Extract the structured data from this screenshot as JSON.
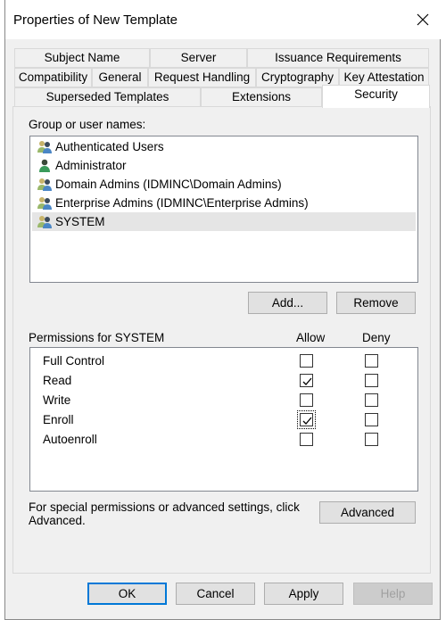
{
  "dialog": {
    "title": "Properties of New Template",
    "close_icon": "close-x"
  },
  "tabs": {
    "row1": [
      {
        "label": "Subject Name"
      },
      {
        "label": "Server"
      },
      {
        "label": "Issuance Requirements"
      }
    ],
    "row2": [
      {
        "label": "Compatibility"
      },
      {
        "label": "General"
      },
      {
        "label": "Request Handling"
      },
      {
        "label": "Cryptography"
      },
      {
        "label": "Key Attestation"
      }
    ],
    "row3": [
      {
        "label": "Superseded Templates"
      },
      {
        "label": "Extensions"
      },
      {
        "label": "Security",
        "selected": true
      }
    ]
  },
  "security": {
    "group_label": "Group or user names:",
    "users": [
      {
        "name": "Authenticated Users",
        "icon": "group-icon"
      },
      {
        "name": "Administrator",
        "icon": "user-icon"
      },
      {
        "name": "Domain Admins (IDMINC\\Domain Admins)",
        "icon": "group-icon"
      },
      {
        "name": "Enterprise Admins (IDMINC\\Enterprise Admins)",
        "icon": "group-icon"
      },
      {
        "name": "SYSTEM",
        "icon": "group-icon",
        "selected": true
      }
    ],
    "add_label": "Add...",
    "remove_label": "Remove",
    "permissions_label": "Permissions for SYSTEM",
    "allow_header": "Allow",
    "deny_header": "Deny",
    "permissions": [
      {
        "name": "Full Control",
        "allow": false,
        "deny": false
      },
      {
        "name": "Read",
        "allow": true,
        "deny": false
      },
      {
        "name": "Write",
        "allow": false,
        "deny": false
      },
      {
        "name": "Enroll",
        "allow": true,
        "deny": false
      },
      {
        "name": "Autoenroll",
        "allow": false,
        "deny": false
      }
    ],
    "advanced_text": "For special permissions or advanced settings, click Advanced.",
    "advanced_label": "Advanced"
  },
  "footer": {
    "ok": "OK",
    "cancel": "Cancel",
    "apply": "Apply",
    "help": "Help"
  }
}
